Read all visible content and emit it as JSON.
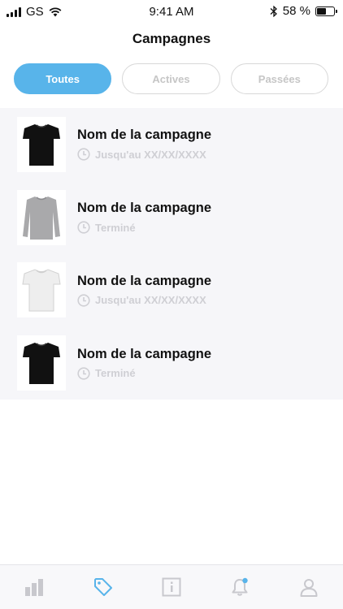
{
  "status_bar": {
    "carrier": "GS",
    "time": "9:41 AM",
    "battery_text": "58 %",
    "battery_level": 0.58
  },
  "header": {
    "title": "Campagnes"
  },
  "filters": [
    {
      "label": "Toutes",
      "active": true
    },
    {
      "label": "Actives",
      "active": false
    },
    {
      "label": "Passées",
      "active": false
    }
  ],
  "campaigns": [
    {
      "name": "Nom de la campagne",
      "status": "Jusqu'au XX/XX/XXXX",
      "product": "black-tshirt"
    },
    {
      "name": "Nom de la campagne",
      "status": "Terminé",
      "product": "grey-long-sleeve"
    },
    {
      "name": "Nom de la campagne",
      "status": "Jusqu'au XX/XX/XXXX",
      "product": "white-tshirt"
    },
    {
      "name": "Nom de la campagne",
      "status": "Terminé",
      "product": "black-tshirt"
    }
  ],
  "tab_bar": {
    "tabs": [
      {
        "icon": "bar-chart-icon",
        "active": false
      },
      {
        "icon": "tag-icon",
        "active": true
      },
      {
        "icon": "info-icon",
        "active": false
      },
      {
        "icon": "bell-icon",
        "active": false,
        "badge": true
      },
      {
        "icon": "user-icon",
        "active": false
      }
    ]
  },
  "colors": {
    "accent": "#58b4ea",
    "inactive_icon": "#c8c8cd",
    "list_bg": "#f6f6f9",
    "meta_text": "#cfcfd4"
  }
}
